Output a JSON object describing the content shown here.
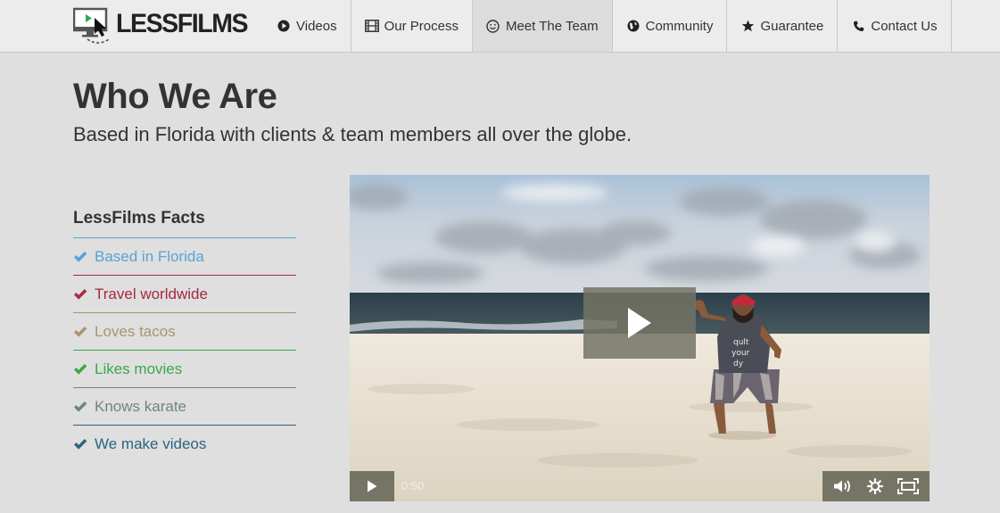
{
  "brand": {
    "name": "LESSFILMS"
  },
  "nav": {
    "items": [
      {
        "label": "Videos",
        "icon": "play-circle-icon",
        "active": false
      },
      {
        "label": "Our Process",
        "icon": "film-icon",
        "active": false
      },
      {
        "label": "Meet The Team",
        "icon": "smile-icon",
        "active": true
      },
      {
        "label": "Community",
        "icon": "globe-icon",
        "active": false
      },
      {
        "label": "Guarantee",
        "icon": "star-icon",
        "active": false
      },
      {
        "label": "Contact Us",
        "icon": "phone-icon",
        "active": false
      }
    ]
  },
  "hero": {
    "title": "Who We Are",
    "subtitle": "Based in Florida with clients & team members all over the globe."
  },
  "facts": {
    "heading": "LessFilms Facts",
    "items": [
      {
        "label": "Based in Florida",
        "color": "#5aa2d6"
      },
      {
        "label": "Travel worldwide",
        "color": "#a8283f"
      },
      {
        "label": "Loves tacos",
        "color": "#a8956d"
      },
      {
        "label": "Likes movies",
        "color": "#3aa845"
      },
      {
        "label": "Knows karate",
        "color": "#6e8585"
      },
      {
        "label": "We make videos",
        "color": "#2b6480"
      }
    ]
  },
  "video": {
    "time": "0:50",
    "controls_color": "#767464"
  }
}
